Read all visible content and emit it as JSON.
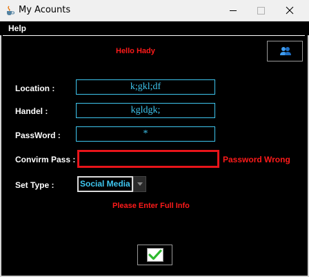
{
  "window": {
    "title": "My Acounts",
    "icon": "java-cup-icon",
    "controls": [
      "minimize-icon",
      "maximize-icon",
      "close-icon"
    ]
  },
  "menu": {
    "items": [
      {
        "label": "Help"
      }
    ]
  },
  "greeting": "Hello Hady",
  "profile_button": {
    "icon": "users-icon"
  },
  "form": {
    "location": {
      "label": "Location :",
      "value": "k;gkl;df"
    },
    "handle": {
      "label": "Handel :",
      "value": "kgldgk;"
    },
    "password": {
      "label": "PassWord :",
      "value": "*"
    },
    "confirm": {
      "label": "Convirm Pass :",
      "value": "",
      "error": "Password Wrong"
    },
    "type": {
      "label": "Set Type :",
      "selected": "Social Media"
    }
  },
  "info_message": "Please Enter Full Info",
  "submit_button": {
    "icon": "checkmark-icon"
  },
  "colors": {
    "background": "#000000",
    "accent": "#3fc7f0",
    "error": "#ff1a1a",
    "error_border": "#e8141a",
    "checkmark": "#2eb82e"
  }
}
